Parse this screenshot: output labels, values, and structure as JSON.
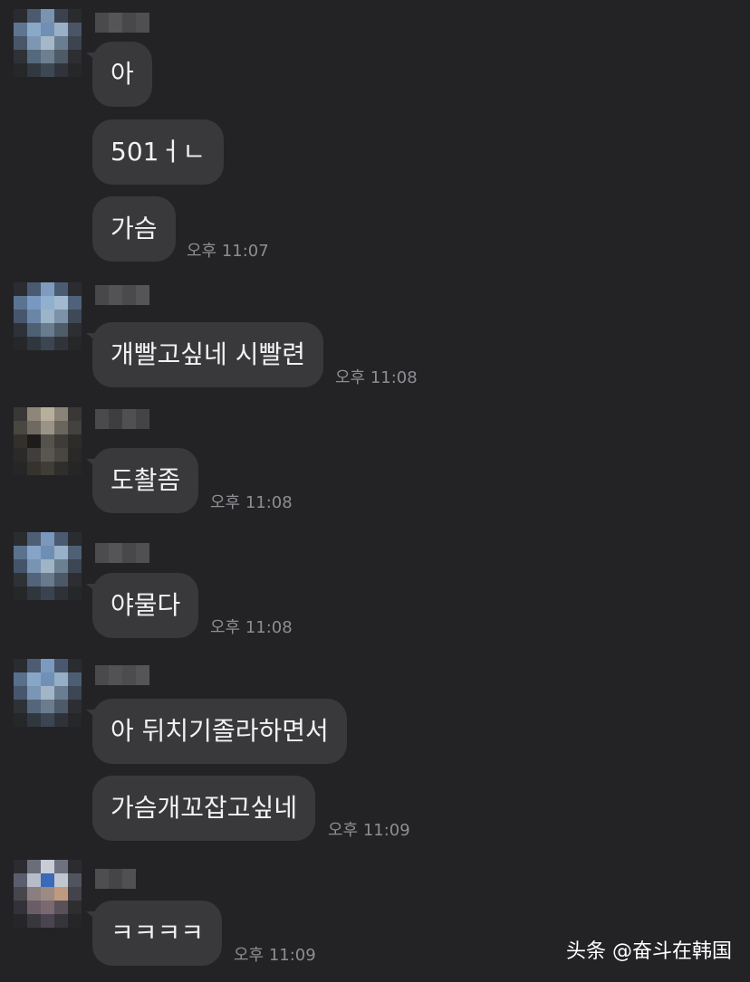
{
  "messages": [
    {
      "text": "아"
    },
    {
      "text": "501ㅓㄴ"
    },
    {
      "text": "가슴",
      "time": "오후 11:07"
    },
    {
      "text": "개빨고싶네 시빨련",
      "time": "오후 11:08"
    },
    {
      "text": "도촬좀",
      "time": "오후 11:08"
    },
    {
      "text": "야물다",
      "time": "오후 11:08"
    },
    {
      "text": "아 뒤치기졸라하면서"
    },
    {
      "text": "가슴개꼬잡고싶네",
      "time": "오후 11:09"
    },
    {
      "text": "ㅋㅋㅋㅋ",
      "time": "오후 11:09"
    }
  ],
  "watermark": "头条 @奋斗在韩国",
  "colors": {
    "background": "#232326",
    "bubble": "#39393c",
    "text": "#f2f2f2",
    "timestamp": "#8e8e92"
  }
}
